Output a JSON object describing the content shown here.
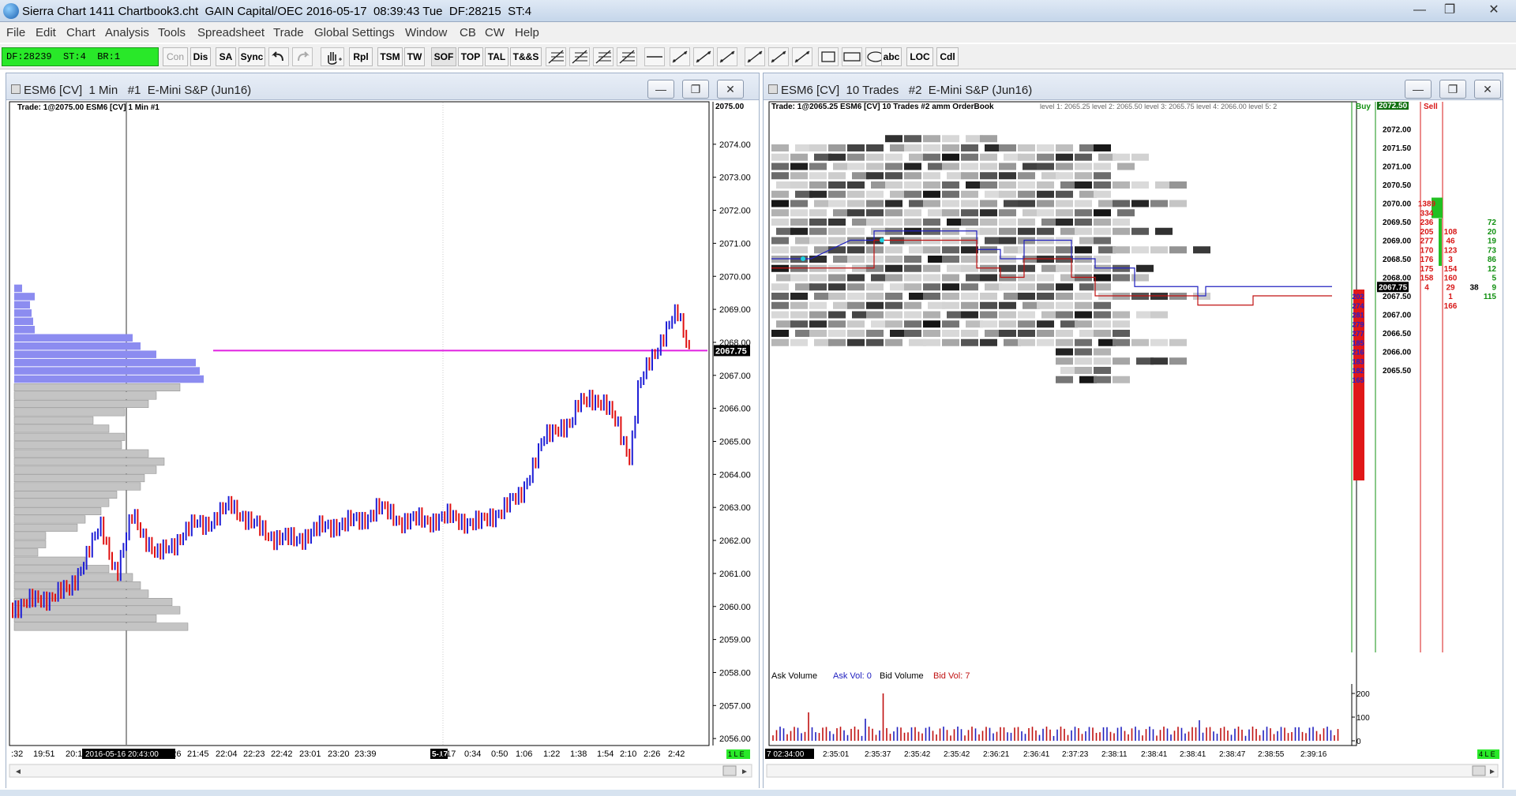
{
  "window": {
    "title": "Sierra Chart 1411 Chartbook3.cht  GAIN Capital/OEC 2016-05-17  08:39:43 Tue  DF:28215  ST:4",
    "controls": [
      "—",
      "❐",
      "✕"
    ]
  },
  "menu": [
    "File",
    "Edit",
    "Chart",
    "Analysis",
    "Tools",
    "Spreadsheet",
    "Trade",
    "Global Settings",
    "Window",
    "CB",
    "CW",
    "Help"
  ],
  "toolbar": {
    "status": "DF:28239  ST:4  BR:1",
    "buttons": [
      "Con",
      "Dis",
      "SA",
      "Sync",
      "Rpl",
      "TSM",
      "TW",
      "SOF",
      "TOP",
      "TAL",
      "T&&S",
      "abc",
      "LOC",
      "Cdl"
    ]
  },
  "left_pane": {
    "title": "ESM6 [CV]  1 Min   #1  E-Mini S&P (Jun16)",
    "header_text": "Trade: 1@2075.00  ESM6 [CV]  1 Min   #1",
    "current_price": "2067.75",
    "top_price_label": "2075.00",
    "price_labels": [
      "2074.00",
      "2073.00",
      "2072.00",
      "2071.00",
      "2070.00",
      "2069.00",
      "2068.00",
      "2067.00",
      "2066.00",
      "2065.00",
      "2064.00",
      "2063.00",
      "2062.00",
      "2061.00",
      "2060.00",
      "2059.00",
      "2058.00",
      "2057.00",
      "2056.00"
    ],
    "time_labels": [
      ":32",
      "19:51",
      "20:1",
      "2016-05-16  20:43:00",
      "7",
      "21:26",
      "21:45",
      "22:04",
      "22:23",
      "22:42",
      "23:01",
      "23:20",
      "23:39",
      "5-17",
      "0:17",
      "0:34",
      "0:50",
      "1:06",
      "1:22",
      "1:38",
      "1:54",
      "2:10",
      "2:26",
      "2:42"
    ],
    "badge": "1 L E"
  },
  "right_pane": {
    "title": "ESM6 [CV]  10 Trades   #2  E-Mini S&P (Jun16)",
    "header_text": "Trade: 1@2065.25  ESM6 [CV]  10 Trades  #2  amm OrderBook",
    "levels_text": "level 1: 2065.25   level 2: 2065.50   level 3: 2065.75   level 4: 2066.00   level 5: 2",
    "buy_label": "Buy",
    "sell_label": "Sell",
    "top_price_label": "2072.50",
    "current_price": "2067.75",
    "price_labels": [
      "2072.00",
      "2071.50",
      "2071.00",
      "2070.50",
      "2070.00",
      "2069.50",
      "2069.00",
      "2068.50",
      "2068.00",
      "2067.50",
      "2067.00",
      "2066.50",
      "2066.00",
      "2065.50"
    ],
    "sell_column": [
      "1389",
      "334",
      "236",
      "205",
      "277",
      "170",
      "176",
      "175",
      "158",
      "4"
    ],
    "mid_column": [
      "108",
      "46",
      "123",
      "3",
      "154",
      "160",
      "29",
      "1",
      "166"
    ],
    "misc_value": "38",
    "buy_column": [
      "72",
      "20",
      "19",
      "73",
      "86",
      "12",
      "5",
      "9",
      "115"
    ],
    "bid_column": [
      "202",
      "274",
      "281",
      "279",
      "277",
      "185",
      "216",
      "183",
      "182",
      "165"
    ],
    "volume_legend": {
      "ask_volume": "Ask Volume",
      "ask_vol": "Ask Vol: 0",
      "bid_volume": "Bid Volume",
      "bid_vol": "Bid Vol: 7"
    },
    "volume_axis": [
      "200",
      "100",
      "0"
    ],
    "time_labels": [
      "7  02:34:00",
      "2:35:01",
      "2:35:37",
      "2:35:42",
      "2:35:42",
      "2:36:21",
      "2:36:41",
      "2:37:23",
      "2:38:11",
      "2:38:41",
      "2:38:41",
      "2:38:47",
      "2:38:55",
      "2:39:16"
    ],
    "badge": "4 L E"
  },
  "colors": {
    "up_bar": "#1f1fd6",
    "down_bar": "#e01010",
    "current_price_line": "#e020e0",
    "profile_upper": "#8c8cf0",
    "profile_lower": "#c4c4c4",
    "status_green": "#29e829",
    "sell_red": "#d81818",
    "buy_green": "#109010"
  }
}
